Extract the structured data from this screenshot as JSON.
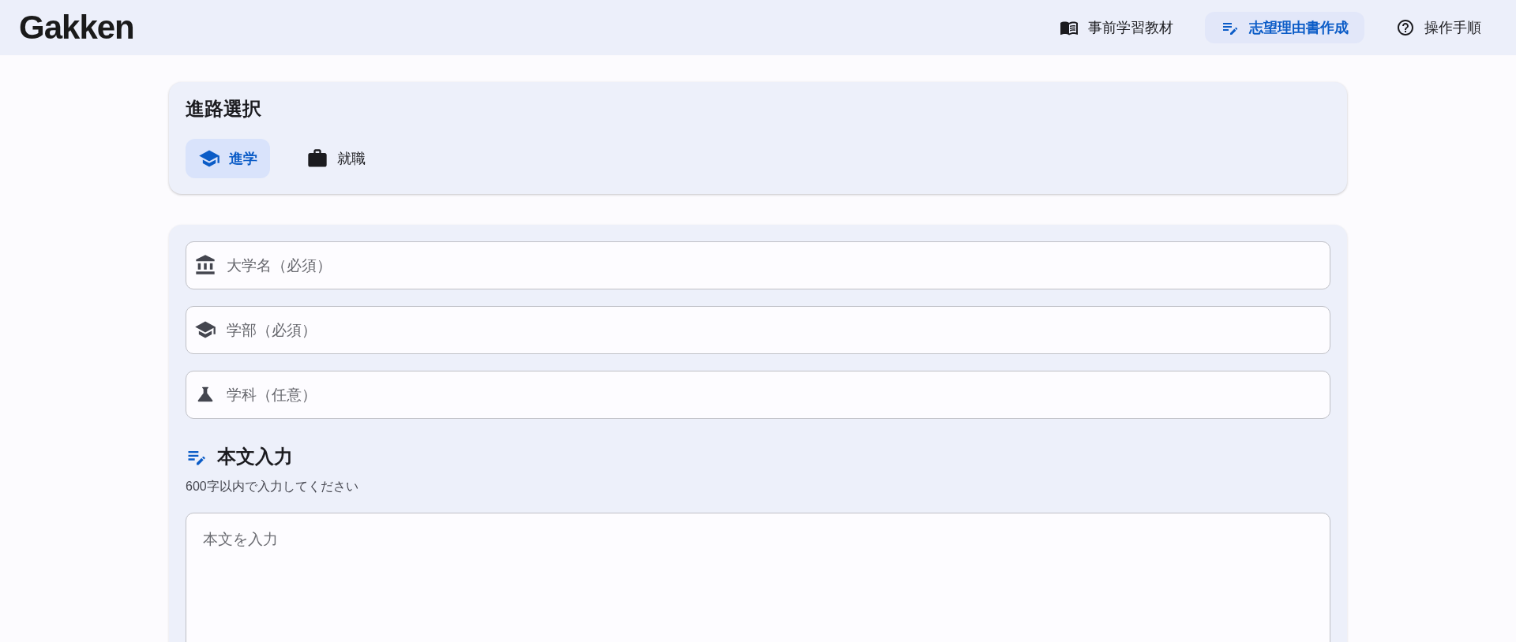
{
  "header": {
    "logo": "Gakken",
    "nav": [
      {
        "label": "事前学習教材",
        "selected": false
      },
      {
        "label": "志望理由書作成",
        "selected": true
      },
      {
        "label": "操作手順",
        "selected": false
      }
    ]
  },
  "path_selection": {
    "title": "進路選択",
    "options": [
      {
        "label": "進学",
        "selected": true
      },
      {
        "label": "就職",
        "selected": false
      }
    ]
  },
  "application_form": {
    "fields": [
      {
        "placeholder": "大学名（必須）"
      },
      {
        "placeholder": "学部（必須）"
      },
      {
        "placeholder": "学科（任意）"
      }
    ],
    "body": {
      "title": "本文入力",
      "hint": "600字以内で入力してください",
      "placeholder": "本文を入力"
    }
  }
}
